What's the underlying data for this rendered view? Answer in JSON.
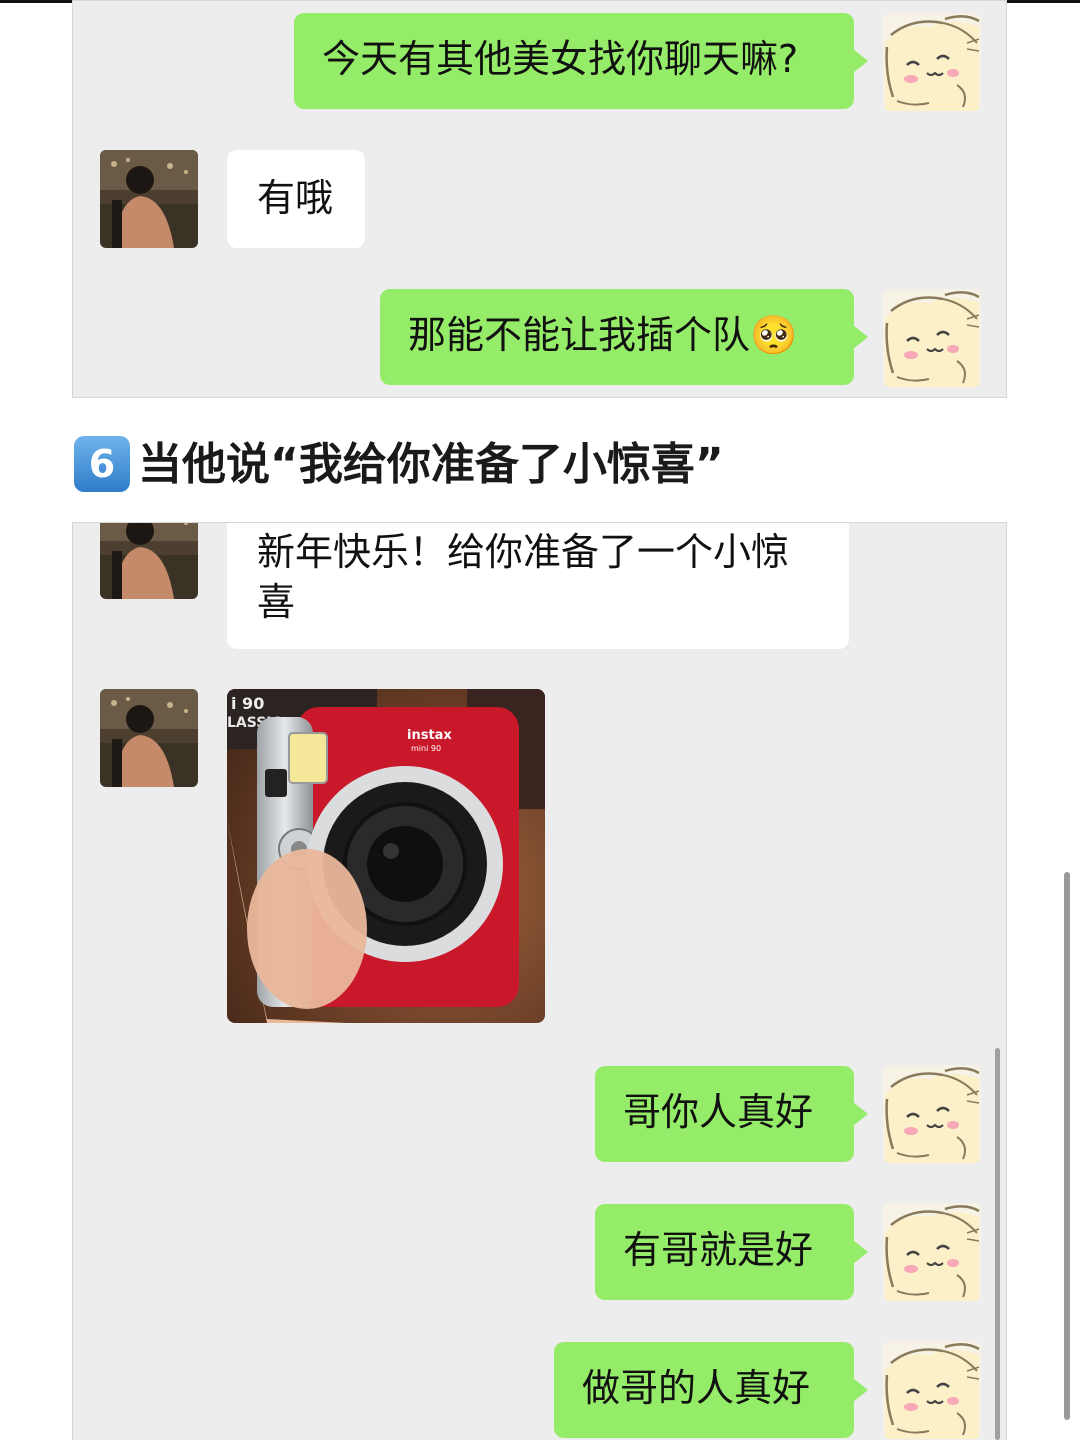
{
  "section1": {
    "messages": [
      {
        "side": "right",
        "text": "今天有其他美女找你聊天嘛?"
      },
      {
        "side": "left",
        "text": "有哦"
      },
      {
        "side": "right",
        "text": "那能不能让我插个队🥺"
      }
    ]
  },
  "heading": {
    "number": "6",
    "text": "当他说“我给你准备了小惊喜”"
  },
  "section2": {
    "messages": [
      {
        "side": "left",
        "text_line1": "新年快乐！给你准备了一个小惊",
        "text_line2": "喜"
      },
      {
        "side": "left",
        "type": "photo",
        "photo_alt": "instax mini 90 red camera"
      },
      {
        "side": "right",
        "text": "哥你人真好"
      },
      {
        "side": "right",
        "text": "有哥就是好"
      },
      {
        "side": "right",
        "text": "做哥的人真好"
      }
    ],
    "camera_brand": "instax",
    "camera_model": "mini 90",
    "box_text_1": "i 90",
    "box_text_2": "LASSIC"
  },
  "colors": {
    "green_bubble": "#95ec69",
    "white_bubble": "#ffffff",
    "panel_bg": "#ededed",
    "camera_red": "#c8182a"
  },
  "icons": {
    "self_avatar": "cartoon-bunny-avatar",
    "other_avatar": "person-concert-avatar"
  }
}
